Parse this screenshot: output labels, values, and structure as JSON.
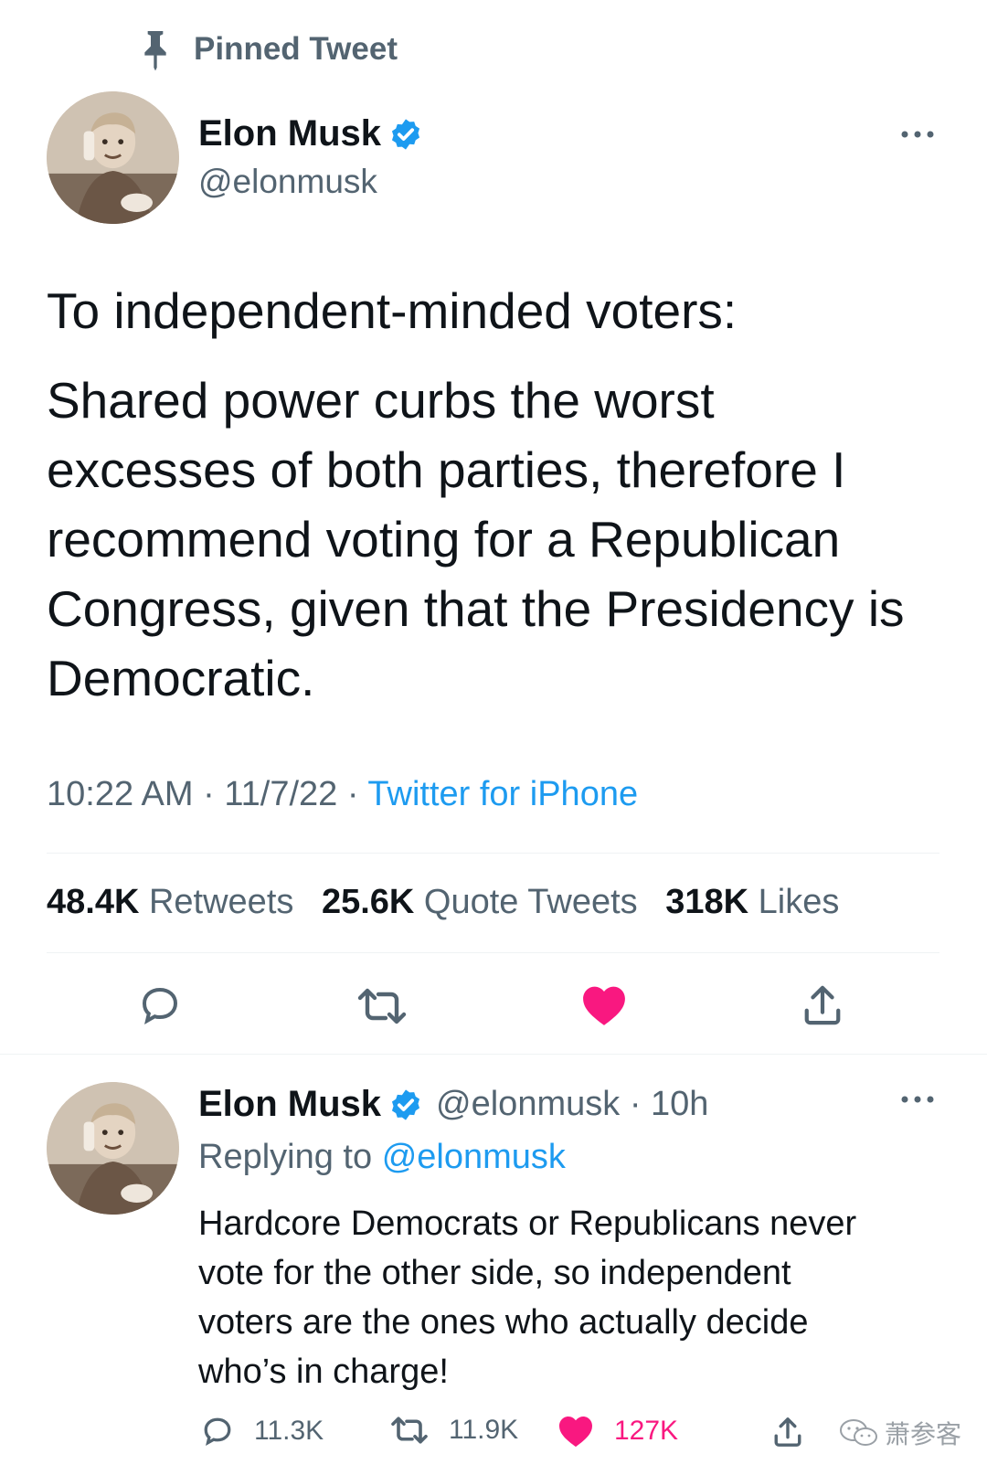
{
  "pinned": {
    "label": "Pinned Tweet",
    "icon": "pin-icon"
  },
  "main_tweet": {
    "author": {
      "display_name": "Elon Musk",
      "handle": "@elonmusk",
      "verified_icon": "verified-badge-icon"
    },
    "lines": [
      "To independent-minded voters:",
      "Shared power curbs the worst",
      "excesses of both parties, therefore I",
      "recommend voting for a Republican",
      "Congress, given that the Presidency is",
      "Democratic."
    ],
    "time": "10:22 AM",
    "date": "11/7/22",
    "separator": "·",
    "source": "Twitter for iPhone",
    "stats": {
      "retweets_count": "48.4K",
      "retweets_label": "Retweets",
      "quotes_count": "25.6K",
      "quotes_label": "Quote Tweets",
      "likes_count": "318K",
      "likes_label": "Likes"
    }
  },
  "reply_tweet": {
    "author": {
      "display_name": "Elon Musk",
      "handle": "@elonmusk",
      "age": "10h"
    },
    "replying_to_label": "Replying to",
    "replying_to_handle": "@elonmusk",
    "lines": [
      "Hardcore Democrats or Republicans never",
      "vote for the other side, so independent",
      "voters are the ones who actually decide",
      "who’s in charge!"
    ],
    "counts": {
      "replies": "11.3K",
      "retweets": "11.9K",
      "likes": "127K"
    }
  },
  "watermark": {
    "text": "萧参客",
    "icon": "wechat-icon"
  },
  "colors": {
    "accent": "#1d9bf0",
    "like": "#f91880",
    "secondary_text": "#536471",
    "divider": "#eff3f4"
  }
}
